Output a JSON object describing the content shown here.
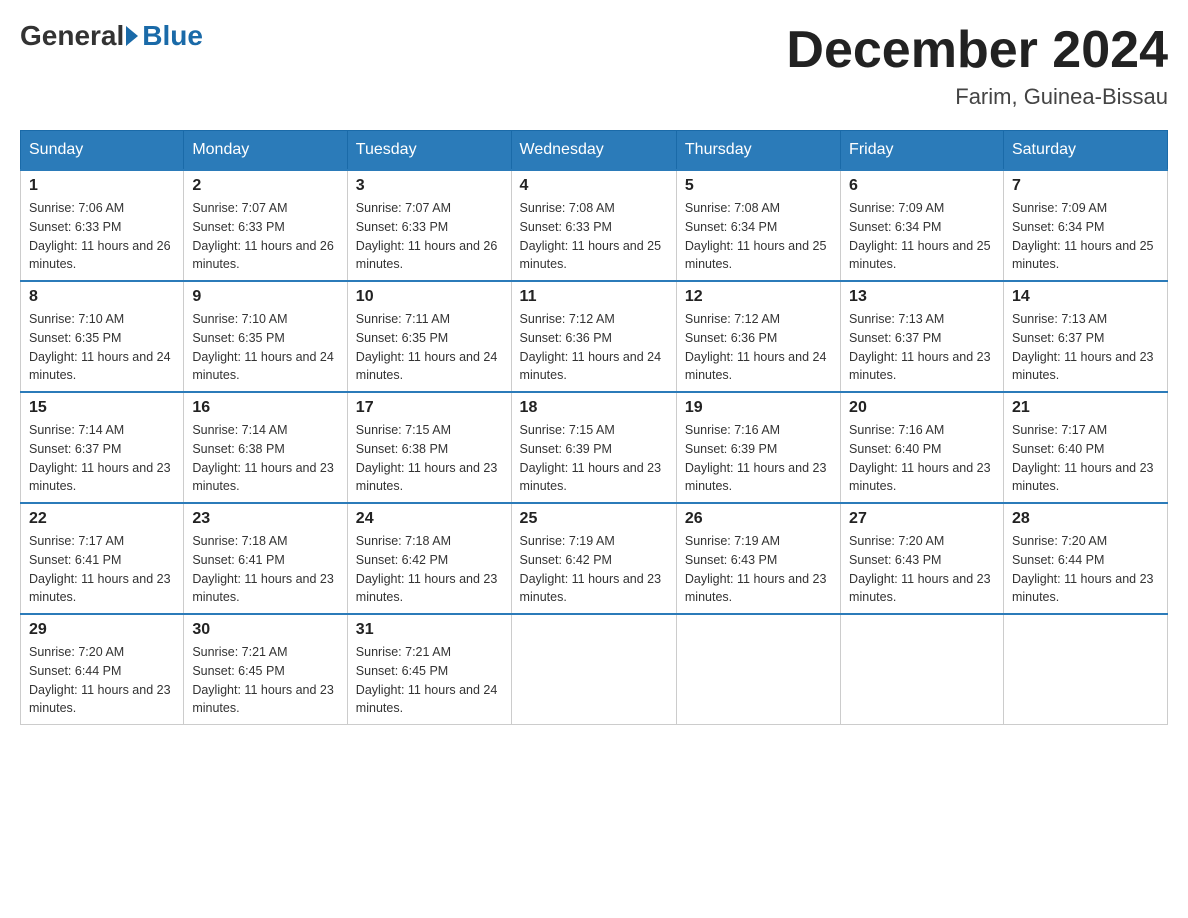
{
  "header": {
    "logo": {
      "general": "General",
      "blue": "Blue"
    },
    "title": "December 2024",
    "subtitle": "Farim, Guinea-Bissau"
  },
  "columns": [
    "Sunday",
    "Monday",
    "Tuesday",
    "Wednesday",
    "Thursday",
    "Friday",
    "Saturday"
  ],
  "weeks": [
    [
      {
        "day": "1",
        "sunrise": "Sunrise: 7:06 AM",
        "sunset": "Sunset: 6:33 PM",
        "daylight": "Daylight: 11 hours and 26 minutes."
      },
      {
        "day": "2",
        "sunrise": "Sunrise: 7:07 AM",
        "sunset": "Sunset: 6:33 PM",
        "daylight": "Daylight: 11 hours and 26 minutes."
      },
      {
        "day": "3",
        "sunrise": "Sunrise: 7:07 AM",
        "sunset": "Sunset: 6:33 PM",
        "daylight": "Daylight: 11 hours and 26 minutes."
      },
      {
        "day": "4",
        "sunrise": "Sunrise: 7:08 AM",
        "sunset": "Sunset: 6:33 PM",
        "daylight": "Daylight: 11 hours and 25 minutes."
      },
      {
        "day": "5",
        "sunrise": "Sunrise: 7:08 AM",
        "sunset": "Sunset: 6:34 PM",
        "daylight": "Daylight: 11 hours and 25 minutes."
      },
      {
        "day": "6",
        "sunrise": "Sunrise: 7:09 AM",
        "sunset": "Sunset: 6:34 PM",
        "daylight": "Daylight: 11 hours and 25 minutes."
      },
      {
        "day": "7",
        "sunrise": "Sunrise: 7:09 AM",
        "sunset": "Sunset: 6:34 PM",
        "daylight": "Daylight: 11 hours and 25 minutes."
      }
    ],
    [
      {
        "day": "8",
        "sunrise": "Sunrise: 7:10 AM",
        "sunset": "Sunset: 6:35 PM",
        "daylight": "Daylight: 11 hours and 24 minutes."
      },
      {
        "day": "9",
        "sunrise": "Sunrise: 7:10 AM",
        "sunset": "Sunset: 6:35 PM",
        "daylight": "Daylight: 11 hours and 24 minutes."
      },
      {
        "day": "10",
        "sunrise": "Sunrise: 7:11 AM",
        "sunset": "Sunset: 6:35 PM",
        "daylight": "Daylight: 11 hours and 24 minutes."
      },
      {
        "day": "11",
        "sunrise": "Sunrise: 7:12 AM",
        "sunset": "Sunset: 6:36 PM",
        "daylight": "Daylight: 11 hours and 24 minutes."
      },
      {
        "day": "12",
        "sunrise": "Sunrise: 7:12 AM",
        "sunset": "Sunset: 6:36 PM",
        "daylight": "Daylight: 11 hours and 24 minutes."
      },
      {
        "day": "13",
        "sunrise": "Sunrise: 7:13 AM",
        "sunset": "Sunset: 6:37 PM",
        "daylight": "Daylight: 11 hours and 23 minutes."
      },
      {
        "day": "14",
        "sunrise": "Sunrise: 7:13 AM",
        "sunset": "Sunset: 6:37 PM",
        "daylight": "Daylight: 11 hours and 23 minutes."
      }
    ],
    [
      {
        "day": "15",
        "sunrise": "Sunrise: 7:14 AM",
        "sunset": "Sunset: 6:37 PM",
        "daylight": "Daylight: 11 hours and 23 minutes."
      },
      {
        "day": "16",
        "sunrise": "Sunrise: 7:14 AM",
        "sunset": "Sunset: 6:38 PM",
        "daylight": "Daylight: 11 hours and 23 minutes."
      },
      {
        "day": "17",
        "sunrise": "Sunrise: 7:15 AM",
        "sunset": "Sunset: 6:38 PM",
        "daylight": "Daylight: 11 hours and 23 minutes."
      },
      {
        "day": "18",
        "sunrise": "Sunrise: 7:15 AM",
        "sunset": "Sunset: 6:39 PM",
        "daylight": "Daylight: 11 hours and 23 minutes."
      },
      {
        "day": "19",
        "sunrise": "Sunrise: 7:16 AM",
        "sunset": "Sunset: 6:39 PM",
        "daylight": "Daylight: 11 hours and 23 minutes."
      },
      {
        "day": "20",
        "sunrise": "Sunrise: 7:16 AM",
        "sunset": "Sunset: 6:40 PM",
        "daylight": "Daylight: 11 hours and 23 minutes."
      },
      {
        "day": "21",
        "sunrise": "Sunrise: 7:17 AM",
        "sunset": "Sunset: 6:40 PM",
        "daylight": "Daylight: 11 hours and 23 minutes."
      }
    ],
    [
      {
        "day": "22",
        "sunrise": "Sunrise: 7:17 AM",
        "sunset": "Sunset: 6:41 PM",
        "daylight": "Daylight: 11 hours and 23 minutes."
      },
      {
        "day": "23",
        "sunrise": "Sunrise: 7:18 AM",
        "sunset": "Sunset: 6:41 PM",
        "daylight": "Daylight: 11 hours and 23 minutes."
      },
      {
        "day": "24",
        "sunrise": "Sunrise: 7:18 AM",
        "sunset": "Sunset: 6:42 PM",
        "daylight": "Daylight: 11 hours and 23 minutes."
      },
      {
        "day": "25",
        "sunrise": "Sunrise: 7:19 AM",
        "sunset": "Sunset: 6:42 PM",
        "daylight": "Daylight: 11 hours and 23 minutes."
      },
      {
        "day": "26",
        "sunrise": "Sunrise: 7:19 AM",
        "sunset": "Sunset: 6:43 PM",
        "daylight": "Daylight: 11 hours and 23 minutes."
      },
      {
        "day": "27",
        "sunrise": "Sunrise: 7:20 AM",
        "sunset": "Sunset: 6:43 PM",
        "daylight": "Daylight: 11 hours and 23 minutes."
      },
      {
        "day": "28",
        "sunrise": "Sunrise: 7:20 AM",
        "sunset": "Sunset: 6:44 PM",
        "daylight": "Daylight: 11 hours and 23 minutes."
      }
    ],
    [
      {
        "day": "29",
        "sunrise": "Sunrise: 7:20 AM",
        "sunset": "Sunset: 6:44 PM",
        "daylight": "Daylight: 11 hours and 23 minutes."
      },
      {
        "day": "30",
        "sunrise": "Sunrise: 7:21 AM",
        "sunset": "Sunset: 6:45 PM",
        "daylight": "Daylight: 11 hours and 23 minutes."
      },
      {
        "day": "31",
        "sunrise": "Sunrise: 7:21 AM",
        "sunset": "Sunset: 6:45 PM",
        "daylight": "Daylight: 11 hours and 24 minutes."
      },
      null,
      null,
      null,
      null
    ]
  ]
}
